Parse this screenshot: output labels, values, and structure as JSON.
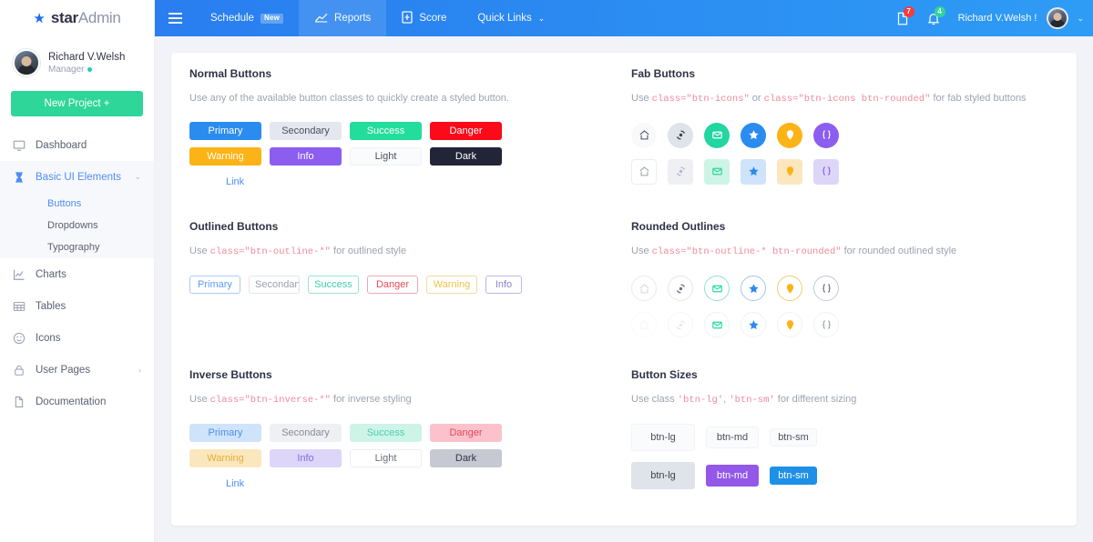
{
  "brand": {
    "star": "★",
    "bold": "star",
    "light": "Admin"
  },
  "sidebar": {
    "profile": {
      "name": "Richard V.Welsh",
      "role": "Manager"
    },
    "new_project_label": "New Project +",
    "items": [
      {
        "label": "Dashboard",
        "icon": "monitor-icon"
      },
      {
        "label": "Basic UI Elements",
        "icon": "hourglass-icon"
      },
      {
        "label": "Charts",
        "icon": "chart-line-icon"
      },
      {
        "label": "Tables",
        "icon": "table-icon"
      },
      {
        "label": "Icons",
        "icon": "smiley-icon"
      },
      {
        "label": "User Pages",
        "icon": "lock-icon"
      },
      {
        "label": "Documentation",
        "icon": "file-icon"
      }
    ],
    "submenu": [
      {
        "label": "Buttons"
      },
      {
        "label": "Dropdowns"
      },
      {
        "label": "Typography"
      }
    ]
  },
  "navbar": {
    "links": [
      {
        "label": "Schedule",
        "badge": "New"
      },
      {
        "label": "Reports",
        "icon": "reports-icon"
      },
      {
        "label": "Score",
        "icon": "score-icon"
      },
      {
        "label": "Quick Links",
        "caret": "⌄"
      }
    ],
    "mail_count": "7",
    "bell_count": "4",
    "user_name": "Richard V.Welsh !"
  },
  "sections": {
    "normal": {
      "title": "Normal Buttons",
      "desc": "Use any of the available button classes to quickly create a styled button.",
      "row1": [
        "Primary",
        "Secondary",
        "Success",
        "Danger"
      ],
      "row2": [
        "Warning",
        "Info",
        "Light",
        "Dark"
      ],
      "link": "Link"
    },
    "fab": {
      "title": "Fab Buttons",
      "desc_pre": "Use ",
      "code1": "class=\"btn-icons\"",
      "desc_mid": " or ",
      "code2": "class=\"btn-icons btn-rounded\"",
      "desc_post": " for fab styled buttons",
      "icons": [
        "home-icon",
        "refresh-icon",
        "envelope-icon",
        "star-icon",
        "map-pin-icon",
        "code-braces-icon"
      ]
    },
    "outlined": {
      "title": "Outlined Buttons",
      "desc_pre": "Use ",
      "code1": "class=\"btn-outline-*\"",
      "desc_post": " for outlined style",
      "row1": [
        "Primary",
        "Secondary",
        "Success",
        "Danger",
        "Warning",
        "Info"
      ]
    },
    "rounded": {
      "title": "Rounded Outlines",
      "desc_pre": "Use ",
      "code1": "class=\"btn-outline-* btn-rounded\"",
      "desc_post": " for rounded outlined style",
      "icons": [
        "home-icon",
        "refresh-icon",
        "envelope-icon",
        "star-icon",
        "map-pin-icon",
        "code-braces-icon"
      ]
    },
    "inverse": {
      "title": "Inverse Buttons",
      "desc_pre": "Use ",
      "code1": "class=\"btn-inverse-*\"",
      "desc_post": " for inverse styling",
      "row1": [
        "Primary",
        "Secondary",
        "Success",
        "Danger"
      ],
      "row2": [
        "Warning",
        "Info",
        "Light",
        "Dark"
      ],
      "link": "Link"
    },
    "sizes": {
      "title": "Button Sizes",
      "desc_pre": "Use class ",
      "code1": "'btn-lg'",
      "desc_mid": ", ",
      "code2": "'btn-sm'",
      "desc_post": " for different sizing",
      "row1": [
        "btn-lg",
        "btn-md",
        "btn-sm"
      ],
      "row2": [
        "btn-lg",
        "btn-md",
        "btn-sm"
      ]
    }
  },
  "colors": {
    "primary": "#2b8cf0",
    "success": "#22dd9c",
    "danger": "#fb0a19",
    "warning": "#fcb316",
    "info": "#8b5ef0",
    "dark": "#222538",
    "navbar": "#2a85f0",
    "accent_green": "#2fd699",
    "code_pink": "#f08a9b"
  }
}
